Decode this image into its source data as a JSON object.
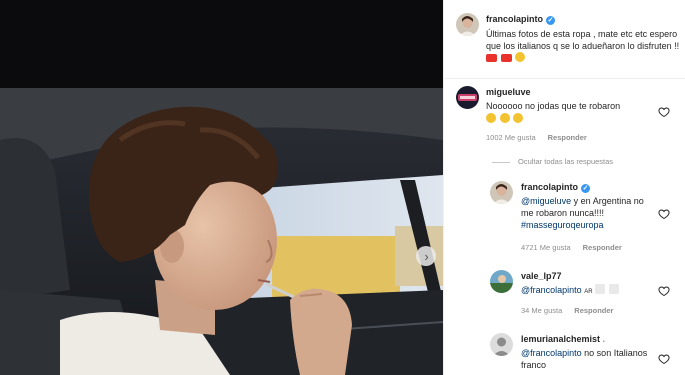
{
  "post": {
    "author": "francolapinto",
    "caption": "Últimas fotos de esta ropa , mate etc etc espero que los italianos q se lo adueñaron lo disfruten !!"
  },
  "comments": [
    {
      "username": "migueluve",
      "text": "Noooooo no jodas que te robaron",
      "likes": "1002 Me gusta",
      "reply_label": "Responder"
    }
  ],
  "hide_replies_label": "Ocultar todas las respuestas",
  "replies": [
    {
      "username": "francolapinto",
      "mention": "@migueluve",
      "text": " y en Argentina no me robaron nunca!!!!",
      "hashtag": "#masseguroqeuropa",
      "likes": "4721 Me gusta",
      "reply_label": "Responder"
    },
    {
      "username": "vale_lp77",
      "mention": "@francolapinto",
      "text": "AR",
      "likes": "34 Me gusta",
      "reply_label": "Responder"
    },
    {
      "username": "lemurianalchemist",
      "mention": "@francolapinto",
      "text": " no son Italianos franco"
    }
  ],
  "colors": {
    "link": "#00376b",
    "verified": "#3897f0",
    "muted": "#8e8e8e"
  },
  "icons": {
    "verified": "verified-badge-icon",
    "like": "heart-icon",
    "next": "chevron-right-icon"
  }
}
